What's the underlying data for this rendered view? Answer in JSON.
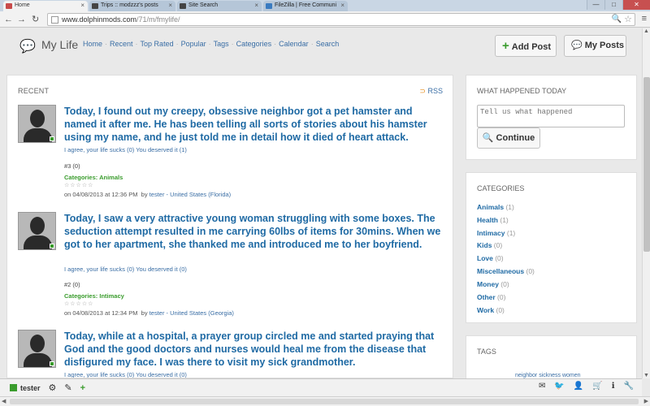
{
  "browser": {
    "tabs": [
      {
        "title": "Home",
        "active": true
      },
      {
        "title": "Trips :: modzzz's posts",
        "active": false
      },
      {
        "title": "Site Search",
        "active": false
      },
      {
        "title": "FileZilla | Free Communi",
        "active": false
      }
    ],
    "tab_close": "×",
    "window_buttons": [
      "—",
      "□",
      "✕"
    ],
    "nav": {
      "back": "←",
      "forward": "→",
      "reload": "↻"
    },
    "url_host": "www.dolphinmods.com",
    "url_path": "/71/m/fmylife/",
    "zoom_icon": "🔍",
    "star_icon": "☆",
    "menu_icon": "≡"
  },
  "header": {
    "logo_icon": "speech-bubbles-icon",
    "logo_glyph": "💬",
    "logo_text": "My Life",
    "nav": [
      "Home",
      "Recent",
      "Top Rated",
      "Popular",
      "Tags",
      "Categories",
      "Calendar",
      "Search"
    ],
    "nav_sep": "·",
    "add_post_icon": "+",
    "add_post_label": "Add Post",
    "my_posts_icon": "💬",
    "my_posts_label": "My Posts"
  },
  "main": {
    "section_title": "RECENT",
    "rss_icon": "⊃",
    "rss_label": "RSS",
    "posts": [
      {
        "text": "Today, I found out my creepy, obsessive neighbor got a pet hamster and named it after me. He has been telling all sorts of stories about his hamster using my name, and he just told me in detail how it died of heart attack.",
        "votes": "I agree, your life sucks (0) You deserved it (1)",
        "number": "#3 (0)",
        "category_label": "Categories:",
        "category": "Animals",
        "stars": "☆☆☆☆☆",
        "date": "on 04/08/2013 at 12:36 PM",
        "by": "by",
        "author": "tester",
        "location": "- United States (Florida)"
      },
      {
        "text": "Today, I saw a very attractive young woman struggling with some boxes. The seduction attempt resulted in me carrying 60lbs of items for 30mins. When we got to her apartment, she thanked me and introduced me to her boyfriend.",
        "votes": "I agree, your life sucks (0) You deserved it (0)",
        "number": "#2 (0)",
        "category_label": "Categories:",
        "category": "Intimacy",
        "stars": "☆☆☆☆☆",
        "date": "on 04/08/2013 at 12:34 PM",
        "by": "by",
        "author": "tester",
        "location": "- United States (Georgia)"
      },
      {
        "text": "Today, while at a hospital, a prayer group circled me and started praying that God and the good doctors and nurses would heal me from the disease that disfigured my face. I was there to visit my sick grandmother.",
        "votes": "I agree, your life sucks (0) You deserved it (0)"
      }
    ]
  },
  "sidebar": {
    "what_title": "WHAT HAPPENED TODAY",
    "what_placeholder": "Tell us what happened",
    "continue_icon": "🔍",
    "continue_label": "Continue",
    "categories_title": "CATEGORIES",
    "categories": [
      {
        "name": "Animals",
        "count": "(1)"
      },
      {
        "name": "Health",
        "count": "(1)"
      },
      {
        "name": "Intimacy",
        "count": "(1)"
      },
      {
        "name": "Kids",
        "count": "(0)"
      },
      {
        "name": "Love",
        "count": "(0)"
      },
      {
        "name": "Miscellaneous",
        "count": "(0)"
      },
      {
        "name": "Money",
        "count": "(0)"
      },
      {
        "name": "Other",
        "count": "(0)"
      },
      {
        "name": "Work",
        "count": "(0)"
      }
    ],
    "tags_title": "TAGS",
    "tags_partial": "neighbor  sickness  women"
  },
  "adminbar": {
    "username": "tester",
    "gear_icon": "⚙",
    "edit_icon": "✎",
    "add_icon": "+",
    "right_icons": [
      "✉",
      "🐦",
      "👤",
      "🛒",
      "ℹ",
      "🔧"
    ]
  },
  "colors": {
    "accent_blue": "#1f6aa4",
    "green": "#3a9c2d",
    "link": "#3a6ea5"
  }
}
